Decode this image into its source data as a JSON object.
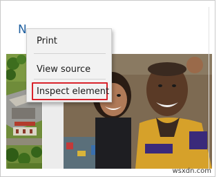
{
  "page": {
    "heading": "N"
  },
  "context_menu": {
    "items": [
      {
        "label": "Print"
      },
      {
        "label": "View source"
      },
      {
        "label": "Inspect element"
      }
    ],
    "highlight_color": "#d9222a"
  },
  "colors": {
    "heading": "#1f5f9f",
    "menu_bg": "#f2f2f2"
  },
  "watermark": "wsxdn.com"
}
